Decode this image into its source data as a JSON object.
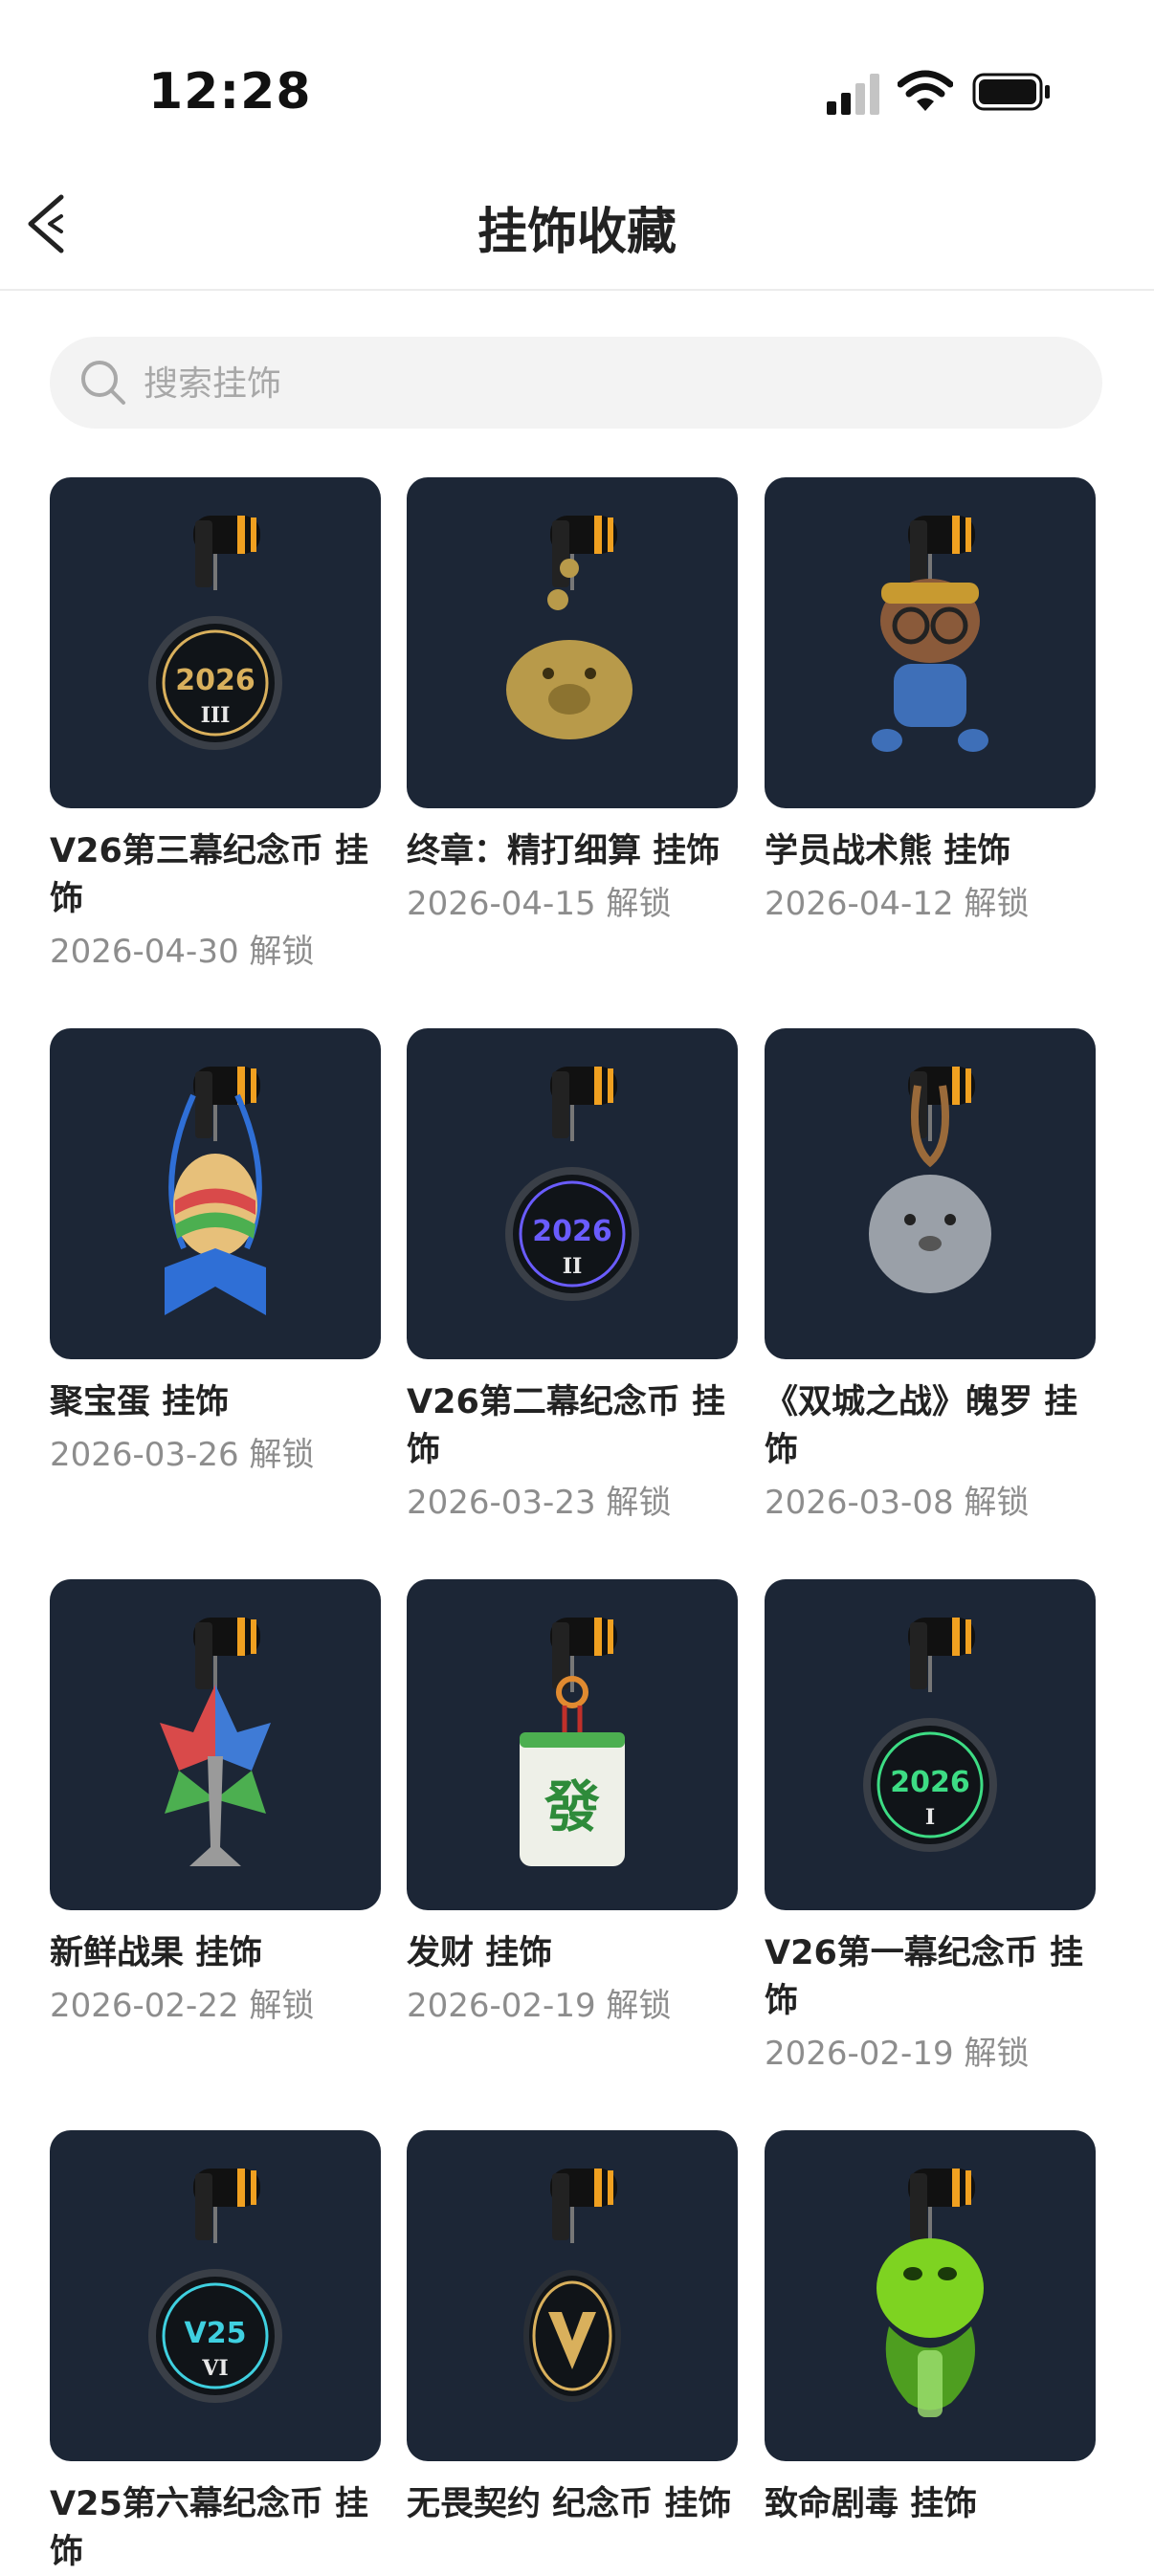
{
  "status_bar": {
    "time": "12:28"
  },
  "nav": {
    "title": "挂饰收藏"
  },
  "search": {
    "placeholder": "搜索挂饰"
  },
  "items": [
    {
      "name": "V26第三幕纪念币 挂饰",
      "date": "2026-04-30 解锁",
      "icon": "medallion-2026-III-icon",
      "accent": "#d9b05c",
      "label": "2026",
      "sub": "III"
    },
    {
      "name": "终章：精打细算 挂饰",
      "date": "2026-04-15 解锁",
      "icon": "gold-piggy-bank-icon",
      "accent": "#b89a4a"
    },
    {
      "name": "学员战术熊 挂饰",
      "date": "2026-04-12 解锁",
      "icon": "tactical-bear-icon",
      "accent": "#8a5a3a"
    },
    {
      "name": "聚宝蛋 挂饰",
      "date": "2026-03-26 解锁",
      "icon": "easter-egg-basket-icon",
      "accent": "#2f6fd6"
    },
    {
      "name": "V26第二幕纪念币 挂饰",
      "date": "2026-03-23 解锁",
      "icon": "medallion-2026-II-icon",
      "accent": "#6a5cff",
      "label": "2026",
      "sub": "II"
    },
    {
      "name": "《双城之战》魄罗 挂饰",
      "date": "2026-03-08 解锁",
      "icon": "poro-icon",
      "accent": "#9aa0a8"
    },
    {
      "name": "新鲜战果 挂饰",
      "date": "2026-02-22 解锁",
      "icon": "maple-leaf-sprig-icon",
      "accent": "#d94a4a"
    },
    {
      "name": "发财 挂饰",
      "date": "2026-02-19 解锁",
      "icon": "mahjong-fa-tile-icon",
      "accent": "#4caf50",
      "label": "發"
    },
    {
      "name": "V26第一幕纪念币 挂饰",
      "date": "2026-02-19 解锁",
      "icon": "medallion-2026-I-icon",
      "accent": "#3ddc84",
      "label": "2026",
      "sub": "I"
    },
    {
      "name": "V25第六幕纪念币 挂饰",
      "date": "",
      "icon": "medallion-v25-VI-icon",
      "accent": "#3fd0e0",
      "label": "V25",
      "sub": "VI"
    },
    {
      "name": "无畏契约 纪念币 挂饰",
      "date": "",
      "icon": "valorant-logo-medallion-icon",
      "accent": "#d9b05c"
    },
    {
      "name": "致命剧毒 挂饰",
      "date": "",
      "icon": "venom-snake-icon",
      "accent": "#7ed321"
    }
  ]
}
